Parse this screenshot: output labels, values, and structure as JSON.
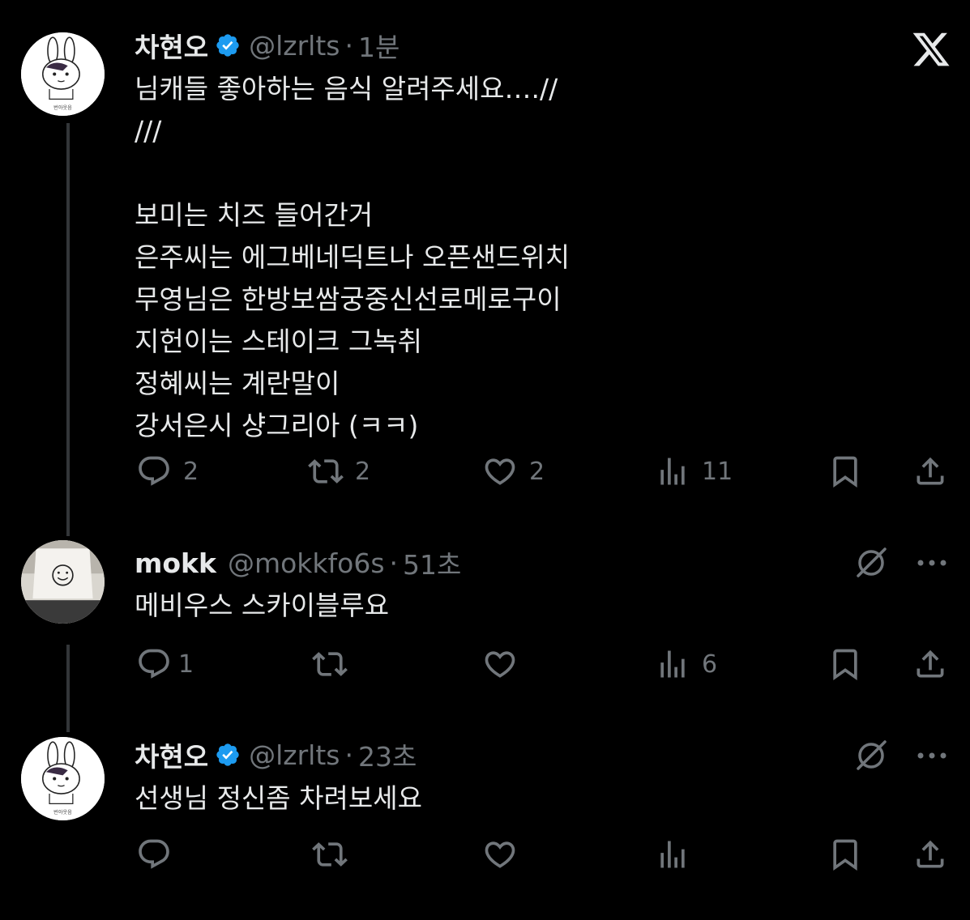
{
  "tweets": [
    {
      "name": "차현오",
      "handle": "@lzrlts",
      "time": "1분",
      "text": "님캐들 좋아하는 음식 알려주세요….//\n///\n\n보미는 치즈 들어간거\n은주씨는 에그베네딕트나 오픈샌드위치\n무영님은 한방보쌈궁중신선로메로구이\n지헌이는 스테이크 그녹취\n정혜씨는 계란말이\n강서은시 샹그리아 (ㅋㅋ)",
      "avatar_caption": "번아웃음",
      "replies": "2",
      "retweets": "2",
      "likes": "2",
      "views": "11"
    },
    {
      "name": "mokk",
      "handle": "@mokkfo6s",
      "time": "51초",
      "text": "메비우스 스카이블루요",
      "replies": "1",
      "retweets": "",
      "likes": "",
      "views": "6"
    },
    {
      "name": "차현오",
      "handle": "@lzrlts",
      "time": "23초",
      "text": "선생님 정신좀 차려보세요",
      "avatar_caption": "번아웃음",
      "replies": "",
      "retweets": "",
      "likes": "",
      "views": ""
    }
  ],
  "icons": {
    "logo": "x-logo-icon",
    "verified": "verified-badge-icon",
    "reply": "reply-icon",
    "retweet": "retweet-icon",
    "like": "heart-icon",
    "views": "views-icon",
    "bookmark": "bookmark-icon",
    "share": "share-icon",
    "grok": "grok-icon",
    "more": "more-icon"
  },
  "colors": {
    "background": "#000000",
    "text": "#e7e9ea",
    "secondary": "#71767b",
    "verified": "#1d9bf0",
    "thread_line": "#333639"
  }
}
